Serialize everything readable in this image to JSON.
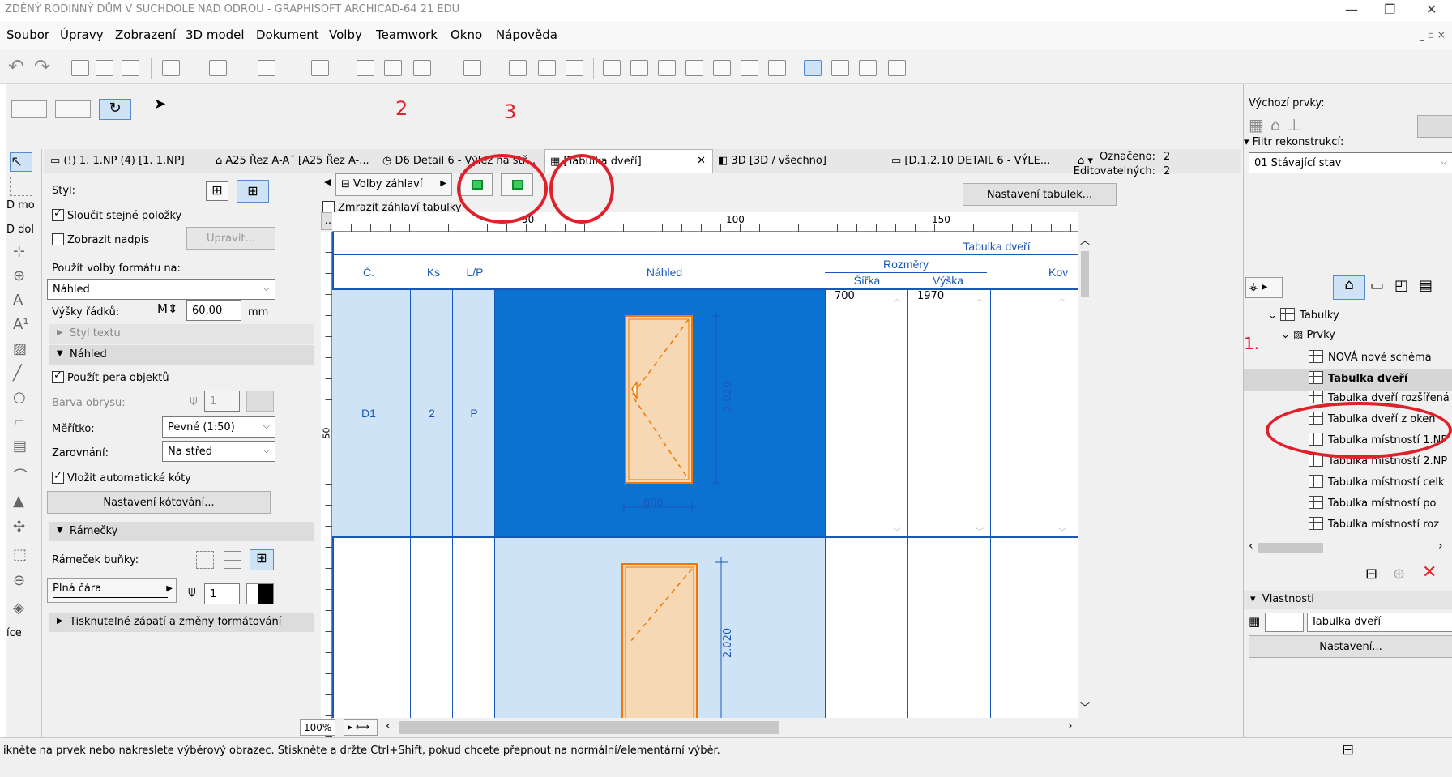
{
  "window": {
    "title": "ZDĚNÝ RODINNÝ DŮM V SUCHDOLE NAD ODROU - GRAPHISOFT ARCHICAD-64 21 EDU"
  },
  "menu": [
    "Soubor",
    "Úpravy",
    "Zobrazení",
    "3D model",
    "Dokument",
    "Volby",
    "Teamwork",
    "Okno",
    "Nápověda"
  ],
  "tabs": [
    "(!) 1. 1.NP (4) [1. 1.NP]",
    "A25 Řez A-A´ [A25 Řez A-...",
    "D6 Detail 6 - Výlez na stř...",
    "[Tabulka dveří]",
    "3D [3D / všechno]",
    "[D.1.2.10 DETAIL 6 - VÝLE..."
  ],
  "left_tools": {
    "mo": "D mo",
    "dol": "D dol"
  },
  "settings": {
    "styl_label": "Styl:",
    "sloucit": "Sloučit stejné položky",
    "zobrazit_nadpis": "Zobrazit nadpis",
    "upravit": "Upravit...",
    "pouzit_volby": "Použít volby formátu na:",
    "nahled_select": "Náhled",
    "vysky_radku": "Výšky řádků:",
    "vyska_value": "60,00",
    "unit_mm": "mm",
    "styl_textu": "Styl textu",
    "nahled_section": "Náhled",
    "pouzit_pera": "Použít pera objektů",
    "barva_obrysu": "Barva obrysu:",
    "barva_value": "1",
    "meritko": "Měřítko:",
    "meritko_value": "Pevné (1:50)",
    "zarovnani": "Zarovnání:",
    "zarovnani_value": "Na střed",
    "vlozit_koty": "Vložit automatické kóty",
    "nastaveni_kotovani": "Nastavení kótování...",
    "ramecky": "Rámečky",
    "ramecek_bunky": "Rámeček buňky:",
    "plna_cara": "Plná čára",
    "pen_value": "1",
    "tisknutelne": "Tisknutelné zápatí a změny formátování"
  },
  "editor": {
    "volby_zahlavi": "Volby záhlaví",
    "zmrazit": "Zmrazit záhlaví tabulky",
    "oznaceno_label": "Označeno:",
    "oznaceno_value": "2",
    "editovatelnych_label": "Editovatelných:",
    "editovatelnych_value": "2",
    "nastaveni_tabulek": "Nastavení tabulek...",
    "more": "...",
    "ruler": [
      "50",
      "100",
      "150"
    ],
    "ruler_v": "50",
    "zoom": "100%"
  },
  "schedule": {
    "title": "Tabulka dveří",
    "headers": {
      "c": "Č.",
      "ks": "Ks",
      "lp": "L/P",
      "nahled": "Náhled",
      "rozmery": "Rozměry",
      "sirka": "Šířka",
      "vyska": "Výška",
      "kov": "Kov"
    },
    "row1": {
      "c": "D1",
      "ks": "2",
      "lp": "P",
      "sirka": "700",
      "vyska": "1970",
      "dim_h": "2.020",
      "dim_w": "800"
    },
    "row2": {
      "dim_h": "2.020"
    }
  },
  "right": {
    "vychozi_prvky": "Výchozí prvky:",
    "filtr": "Filtr rekonstrukcí:",
    "filtr_value": "01 Stávající stav",
    "tree_root": "Tabulky",
    "tree_prvky": "Prvky",
    "items": [
      "NOVÁ nové schéma",
      "Tabulka dveří",
      "Tabulka dveří rozšířená",
      "Tabulka dveří z oken",
      "Tabulka místností 1.NP",
      "Tabulka místností 2.NP",
      "Tabulka místností celk",
      "Tabulka místností po",
      "Tabulka místností roz"
    ],
    "vlastnosti": "Vlastnosti",
    "name_value": "Tabulka dveří",
    "nastaveni": "Nastavení..."
  },
  "annotations": {
    "n1": "1.",
    "n2": "2",
    "n3": "3"
  },
  "status": "ikněte na prvek nebo nakreslete výběrový obrazec. Stiskněte a držte Ctrl+Shift, pokud chcete přepnout na normální/elementární výběr.",
  "colors": {
    "selected_row": "#0c72d2",
    "light_blue": "#cfe3f6",
    "door_fill": "#f6d8b4",
    "door_stroke": "#f07800",
    "accent_red": "#e0212b",
    "table_blue": "#1a58b8"
  }
}
